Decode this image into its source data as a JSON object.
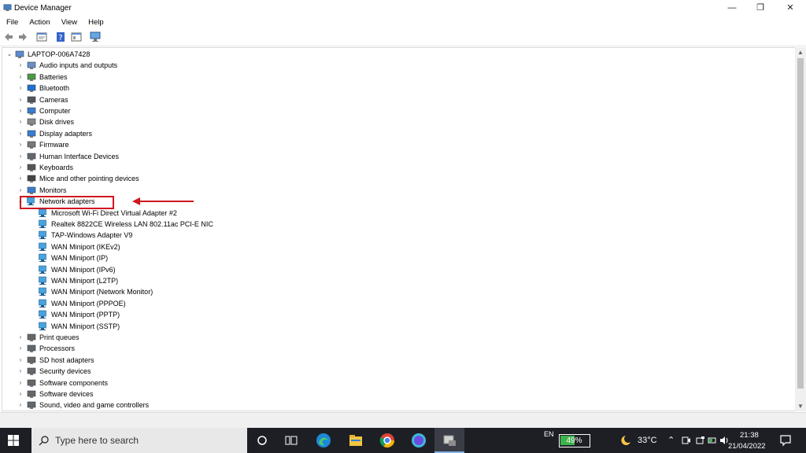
{
  "window": {
    "title": "Device Manager",
    "minimize": "—",
    "restore": "❐",
    "close": "✕"
  },
  "menu": [
    "File",
    "Action",
    "View",
    "Help"
  ],
  "tree": {
    "root": "LAPTOP-006A7428",
    "categories": [
      "Audio inputs and outputs",
      "Batteries",
      "Bluetooth",
      "Cameras",
      "Computer",
      "Disk drives",
      "Display adapters",
      "Firmware",
      "Human Interface Devices",
      "Keyboards",
      "Mice and other pointing devices",
      "Monitors",
      "Network adapters"
    ],
    "network_adapters": [
      "Microsoft Wi-Fi Direct Virtual Adapter #2",
      "Realtek 8822CE Wireless LAN 802.11ac PCI-E NIC",
      "TAP-Windows Adapter V9",
      "WAN Miniport (IKEv2)",
      "WAN Miniport (IP)",
      "WAN Miniport (IPv6)",
      "WAN Miniport (L2TP)",
      "WAN Miniport (Network Monitor)",
      "WAN Miniport (PPPOE)",
      "WAN Miniport (PPTP)",
      "WAN Miniport (SSTP)"
    ],
    "categories_after": [
      "Print queues",
      "Processors",
      "SD host adapters",
      "Security devices",
      "Software components",
      "Software devices",
      "Sound, video and game controllers"
    ]
  },
  "annotation": {
    "color": "#d0161f"
  },
  "taskbar": {
    "search_placeholder": "Type here to search",
    "language": "EN",
    "battery": "49%",
    "battery_level": 0.49,
    "weather": "33°C",
    "time": "21:38",
    "date": "21/04/2022"
  }
}
